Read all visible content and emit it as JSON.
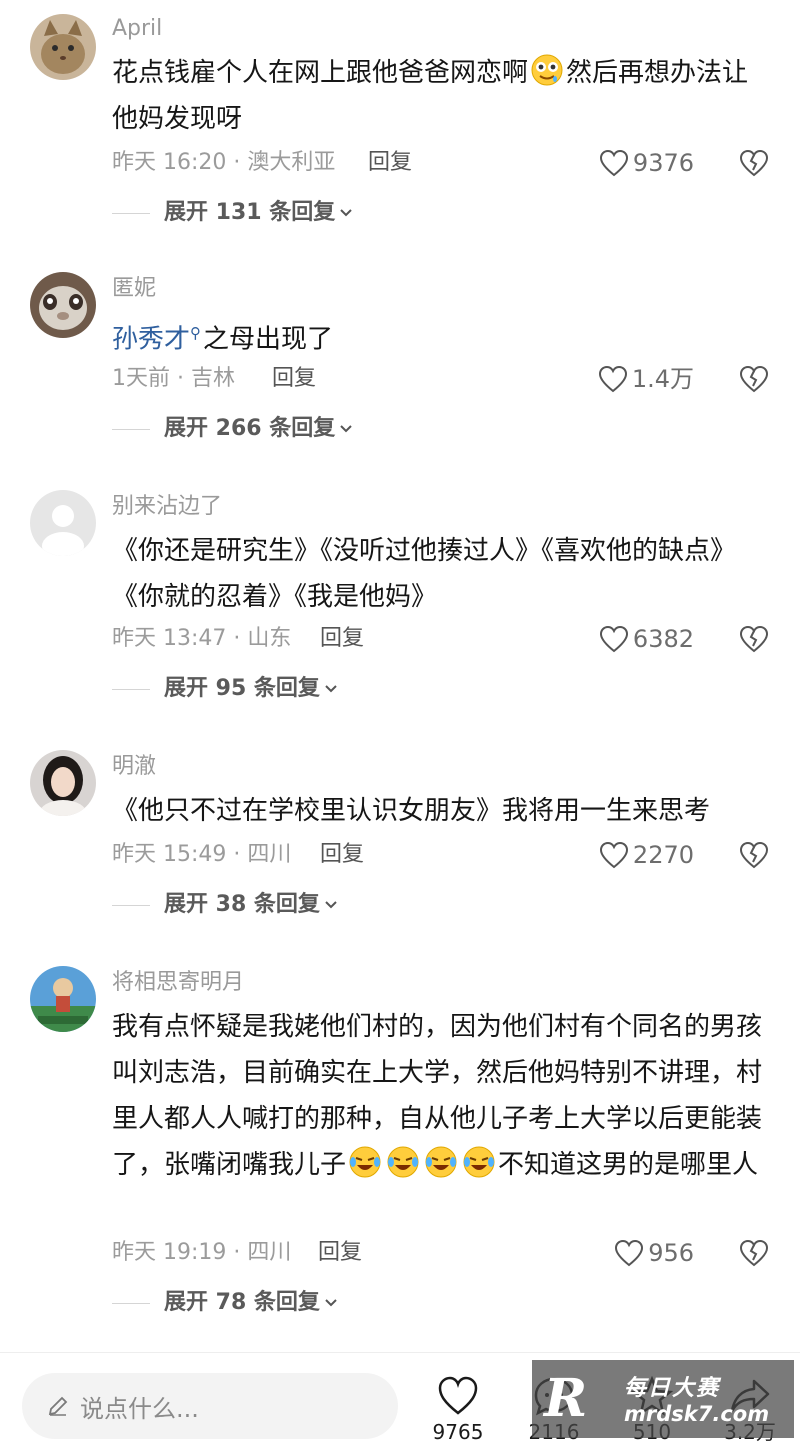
{
  "comments": [
    {
      "username": "April",
      "text_parts": [
        "花点钱雇个人在网上跟他爸爸网恋啊",
        "然后再想办法让他妈发现呀"
      ],
      "emoji": "drooling-face-emoji",
      "meta": "昨天 16:20 · 澳大利亚",
      "reply": "回复",
      "likes": "9376",
      "expand": "展开 131 条回复"
    },
    {
      "username": "匿妮",
      "mention": "孙秀才",
      "text": "之母出现了",
      "meta": "1天前 · 吉林",
      "reply": "回复",
      "likes": "1.4万",
      "expand": "展开 266 条回复"
    },
    {
      "username": "别来沾边了",
      "text": "《你还是研究生》《没听过他揍过人》《喜欢他的缺点》《你就的忍着》《我是他妈》",
      "meta": "昨天 13:47 · 山东",
      "reply": "回复",
      "likes": "6382",
      "expand": "展开 95 条回复"
    },
    {
      "username": "明澈",
      "text": "《他只不过在学校里认识女朋友》我将用一生来思考",
      "meta": "昨天 15:49 · 四川",
      "reply": "回复",
      "likes": "2270",
      "expand": "展开 38 条回复"
    },
    {
      "username": "将相思寄明月",
      "text_parts": [
        "我有点怀疑是我姥他们村的，因为他们村有个同名的男孩叫刘志浩，目前确实在上大学，然后他妈特别不讲理，村里人都人人喊打的那种，自从他儿子考上大学以后更能装了，张嘴闭嘴我儿子",
        "不知道这男的是哪里人"
      ],
      "emoji": "laughing-crying-emoji",
      "meta": "昨天 19:19 · 四川",
      "reply": "回复",
      "likes": "956",
      "expand": "展开 78 条回复"
    }
  ],
  "bottom_bar": {
    "input_placeholder": "说点什么...",
    "like_count": "9765",
    "comment_count": "2116",
    "favorite_count": "510",
    "share_count": "3.2万"
  },
  "watermark": {
    "logo": "R",
    "name": "每日大赛",
    "url": "mrdsk7.com"
  },
  "colors": {
    "mention": "#2f5f9e",
    "meta_gray": "#9b9b9b",
    "input_bg": "#f3f3f3"
  }
}
